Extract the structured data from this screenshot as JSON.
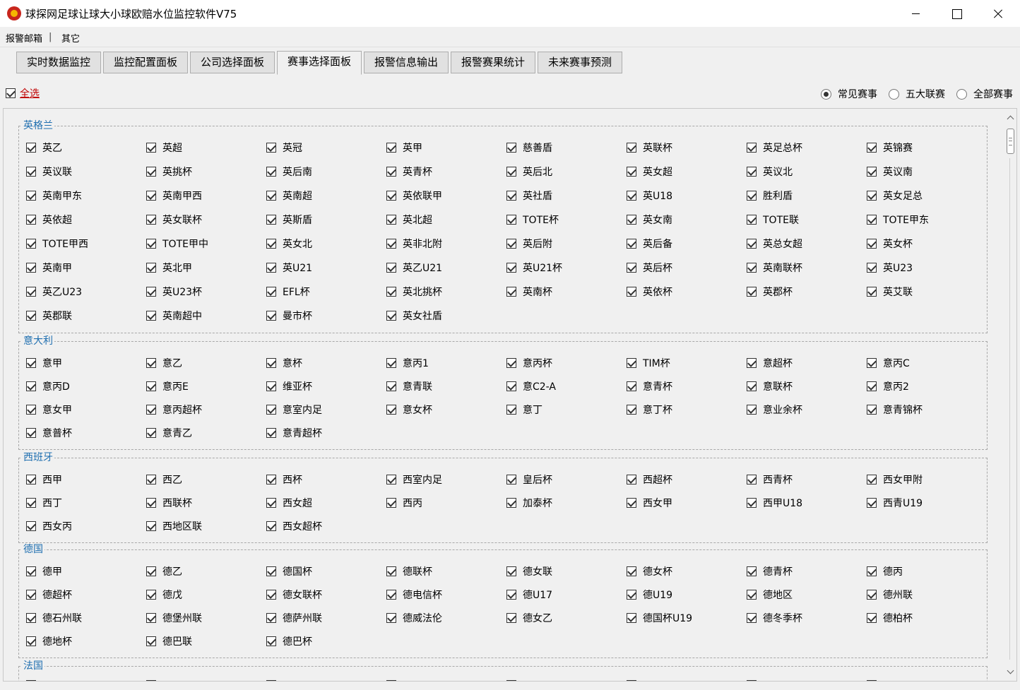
{
  "window": {
    "title": "球探网足球让球大小球欧赔水位监控软件V75"
  },
  "menu": {
    "items": [
      "报警邮箱",
      "其它"
    ],
    "separator": "|"
  },
  "tabs": [
    "实时数据监控",
    "监控配置面板",
    "公司选择面板",
    "赛事选择面板",
    "报警信息输出",
    "报警赛果统计",
    "未来赛事预测"
  ],
  "active_tab": 3,
  "select_all": {
    "label": "全选",
    "checked": true
  },
  "filters": [
    {
      "label": "常见赛事",
      "selected": true
    },
    {
      "label": "五大联赛",
      "selected": false
    },
    {
      "label": "全部赛事",
      "selected": false
    }
  ],
  "groups": [
    {
      "name": "英格兰",
      "leagues": [
        "英乙",
        "英超",
        "英冠",
        "英甲",
        "慈善盾",
        "英联杯",
        "英足总杯",
        "英锦赛",
        "英议联",
        "英挑杯",
        "英后南",
        "英青杯",
        "英后北",
        "英女超",
        "英议北",
        "英议南",
        "英南甲东",
        "英南甲西",
        "英南超",
        "英依联甲",
        "英社盾",
        "英U18",
        "胜利盾",
        "英女足总",
        "英依超",
        "英女联杯",
        "英斯盾",
        "英北超",
        "TOTE杯",
        "英女南",
        "TOTE联",
        "TOTE甲东",
        "TOTE甲西",
        "TOTE甲中",
        "英女北",
        "英非北附",
        "英后附",
        "英后备",
        "英总女超",
        "英女杯",
        "英南甲",
        "英北甲",
        "英U21",
        "英乙U21",
        "英U21杯",
        "英后杯",
        "英南联杯",
        "英U23",
        "英乙U23",
        "英U23杯",
        "EFL杯",
        "英北挑杯",
        "英南杯",
        "英依杯",
        "英郡杯",
        "英艾联",
        "英郡联",
        "英南超中",
        "曼市杯",
        "英女社盾"
      ]
    },
    {
      "name": "意大利",
      "leagues": [
        "意甲",
        "意乙",
        "意杯",
        "意丙1",
        "意丙杯",
        "TIM杯",
        "意超杯",
        "意丙C",
        "意丙D",
        "意丙E",
        "维亚杯",
        "意青联",
        "意C2-A",
        "意青杯",
        "意联杯",
        "意丙2",
        "意女甲",
        "意丙超杯",
        "意室内足",
        "意女杯",
        "意丁",
        "意丁杯",
        "意业余杯",
        "意青锦杯",
        "意普杯",
        "意青乙",
        "意青超杯"
      ]
    },
    {
      "name": "西班牙",
      "leagues": [
        "西甲",
        "西乙",
        "西杯",
        "西室内足",
        "皇后杯",
        "西超杯",
        "西青杯",
        "西女甲附",
        "西丁",
        "西联杯",
        "西女超",
        "西丙",
        "加泰杯",
        "西女甲",
        "西甲U18",
        "西青U19",
        "西女丙",
        "西地区联",
        "西女超杯"
      ]
    },
    {
      "name": "德国",
      "leagues": [
        "德甲",
        "德乙",
        "德国杯",
        "德联杯",
        "德女联",
        "德女杯",
        "德青杯",
        "德丙",
        "德超杯",
        "德戊",
        "德女联杯",
        "德电信杯",
        "德U17",
        "德U19",
        "德地区",
        "德州联",
        "德石州联",
        "德堡州联",
        "德萨州联",
        "德威法伦",
        "德女乙",
        "德国杯U19",
        "德冬季杯",
        "德柏杯",
        "德地杯",
        "德巴联",
        "德巴杯"
      ]
    },
    {
      "name": "法国",
      "leagues": []
    }
  ]
}
